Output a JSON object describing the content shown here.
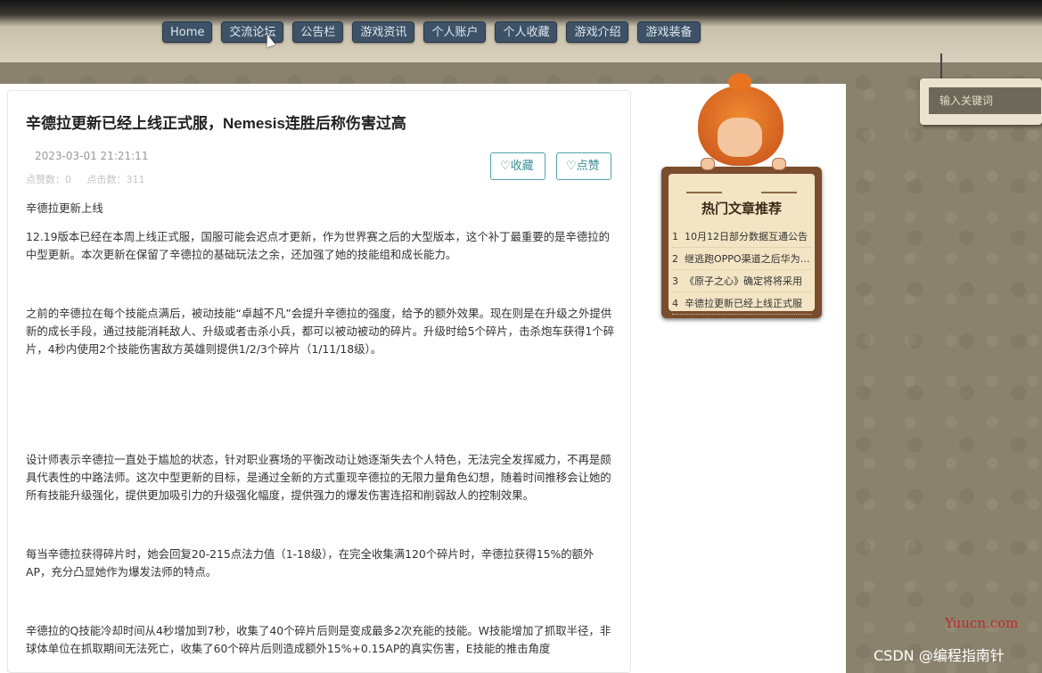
{
  "nav": {
    "items": [
      {
        "label": "Home"
      },
      {
        "label": "交流论坛"
      },
      {
        "label": "公告栏"
      },
      {
        "label": "游戏资讯"
      },
      {
        "label": "个人账户"
      },
      {
        "label": "个人收藏"
      },
      {
        "label": "游戏介绍"
      },
      {
        "label": "游戏装备"
      }
    ]
  },
  "article": {
    "title": "辛德拉更新已经上线正式服，Nemesis连胜后称伤害过高",
    "date": "2023-03-01 21:21:11",
    "likes_label": "点赞数：0",
    "clicks_label": "点击数：311",
    "fav_button": "♡收藏",
    "like_button": "♡点赞",
    "paragraphs": [
      "辛德拉更新上线",
      "12.19版本已经在本周上线正式服，国服可能会迟点才更新，作为世界赛之后的大型版本，这个补丁最重要的是辛德拉的中型更新。本次更新在保留了辛德拉的基础玩法之余，还加强了她的技能组和成长能力。",
      "之前的辛德拉在每个技能点满后，被动技能“卓越不凡”会提升辛德拉的强度，给予的额外效果。现在则是在升级之外提供新的成长手段，通过技能消耗敌人、升级或者击杀小兵，都可以被动被动的碎片。升级时给5个碎片，击杀炮车获得1个碎片，4秒内使用2个技能伤害敌方英雄则提供1/2/3个碎片（1/11/18级）。",
      "设计师表示辛德拉一直处于尴尬的状态，针对职业赛场的平衡改动让她逐渐失去个人特色，无法完全发挥威力，不再是颇具代表性的中路法师。这次中型更新的目标，是通过全新的方式重现辛德拉的无限力量角色幻想，随着时间推移会让她的所有技能升级强化，提供更加吸引力的升级强化幅度，提供强力的爆发伤害连招和削弱敌人的控制效果。",
      "每当辛德拉获得碎片时，她会回复20-215点法力值（1-18级），在完全收集满120个碎片时，辛德拉获得15%的额外AP，充分凸显她作为爆发法师的特点。",
      "辛德拉的Q技能冷却时间从4秒增加到7秒，收集了40个碎片后则是变成最多2次充能的技能。W技能增加了抓取半径，非球体单位在抓取期间无法死亡，收集了60个碎片后则造成额外15%+0.15AP的真实伤害，E技能的推击角度"
    ]
  },
  "sidebar": {
    "hot_title": "热门文章推荐",
    "hot_items": [
      {
        "num": "1",
        "text": "10月12日部分数据互通公告"
      },
      {
        "num": "2",
        "text": "继逃跑OPPO渠道之后华为渠道"
      },
      {
        "num": "3",
        "text": "《原子之心》确定将将采用"
      },
      {
        "num": "4",
        "text": "辛德拉更新已经上线正式服"
      }
    ]
  },
  "search": {
    "placeholder": "输入关键词"
  },
  "watermarks": {
    "site": "Yuucn.com",
    "author": "CSDN @编程指南针"
  }
}
